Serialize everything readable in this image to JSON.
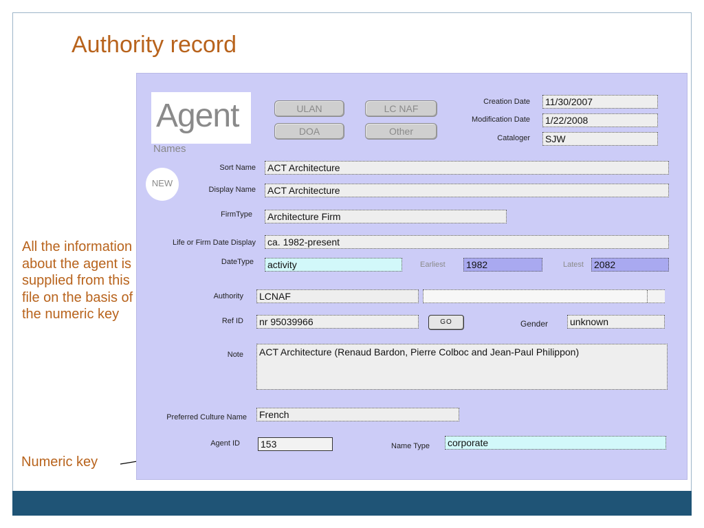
{
  "slide": {
    "title": "Authority record",
    "side_note": "All the information about the agent is supplied from this file on the basis of the numeric key",
    "numeric_key_label": "Numeric key"
  },
  "form": {
    "heading": "Agent",
    "names_label": "Names",
    "new_badge": "NEW",
    "buttons": {
      "ulan": "ULAN",
      "lcnaf": "LC NAF",
      "doa": "DOA",
      "other": "Other",
      "go": "GO"
    },
    "labels": {
      "creation_date": "Creation Date",
      "modification_date": "Modification Date",
      "cataloger": "Cataloger",
      "sort_name": "Sort Name",
      "display_name": "Display Name",
      "firm_type": "FirmType",
      "life_firm_date_display": "Life or Firm Date Display",
      "date_type": "DateType",
      "earliest": "Earliest",
      "latest": "Latest",
      "authority": "Authority",
      "ref_id": "Ref ID",
      "gender": "Gender",
      "note": "Note",
      "preferred_culture_name": "Preferred Culture Name",
      "agent_id": "Agent ID",
      "name_type": "Name Type"
    },
    "values": {
      "creation_date": "11/30/2007",
      "modification_date": "1/22/2008",
      "cataloger": "SJW",
      "sort_name": "ACT Architecture",
      "display_name": "ACT Architecture",
      "firm_type": "Architecture Firm",
      "life_firm_date_display": "ca. 1982-present",
      "date_type": "activity",
      "earliest": "1982",
      "latest": "2082",
      "authority": "LCNAF",
      "authority_extra": "",
      "ref_id": "nr 95039966",
      "gender": "unknown",
      "note": "ACT Architecture (Renaud Bardon, Pierre Colboc and Jean-Paul Philippon)",
      "preferred_culture_name": "French",
      "agent_id": "153",
      "name_type": "corporate"
    }
  },
  "colors": {
    "title_orange": "#b8631c",
    "panel_lavender": "#ccccf7",
    "band_blue": "#1f5476",
    "cyan_field": "#d2f8fa",
    "violet_field": "#a9a9f0"
  }
}
